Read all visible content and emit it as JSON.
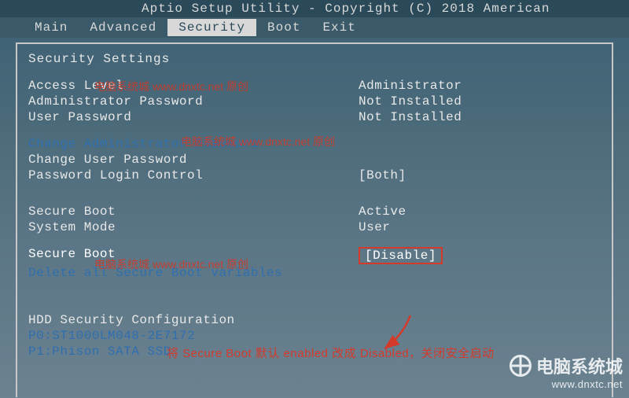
{
  "title": "Aptio Setup Utility - Copyright (C) 2018 American",
  "menu": {
    "items": [
      "Main",
      "Advanced",
      "Security",
      "Boot",
      "Exit"
    ],
    "active_index": 2
  },
  "panel": {
    "heading": "Security Settings",
    "access_level": {
      "label": "Access Level",
      "value": "Administrator"
    },
    "admin_pw": {
      "label": "Administrator Password",
      "value": "Not Installed"
    },
    "user_pw": {
      "label": "User Password",
      "value": "Not Installed"
    },
    "change_admin": {
      "label": "Change Administrator Password"
    },
    "change_user": {
      "label": "Change User Password"
    },
    "pw_login": {
      "label": "Password Login Control",
      "value": "[Both]"
    },
    "secure_boot_status": {
      "label": "Secure Boot",
      "value": "Active"
    },
    "system_mode": {
      "label": "System Mode",
      "value": "User"
    },
    "secure_boot": {
      "label": "Secure Boot",
      "value": "[Disable]"
    },
    "delete_vars": {
      "label": "Delete all Secure Boot variables"
    },
    "hdd_heading": "HDD Security Configuration",
    "hdd0": "P0:ST1000LM048-2E7172",
    "hdd1": "P1:Phison SATA SSD"
  },
  "annotation": "将 Secure Boot 默认 enabled 改成 Disabled，关闭安全启动",
  "watermark": "电脑系统城 www.dnxtc.net 原创",
  "site": {
    "name": "电脑系统城",
    "url": "www.dnxtc.net"
  }
}
